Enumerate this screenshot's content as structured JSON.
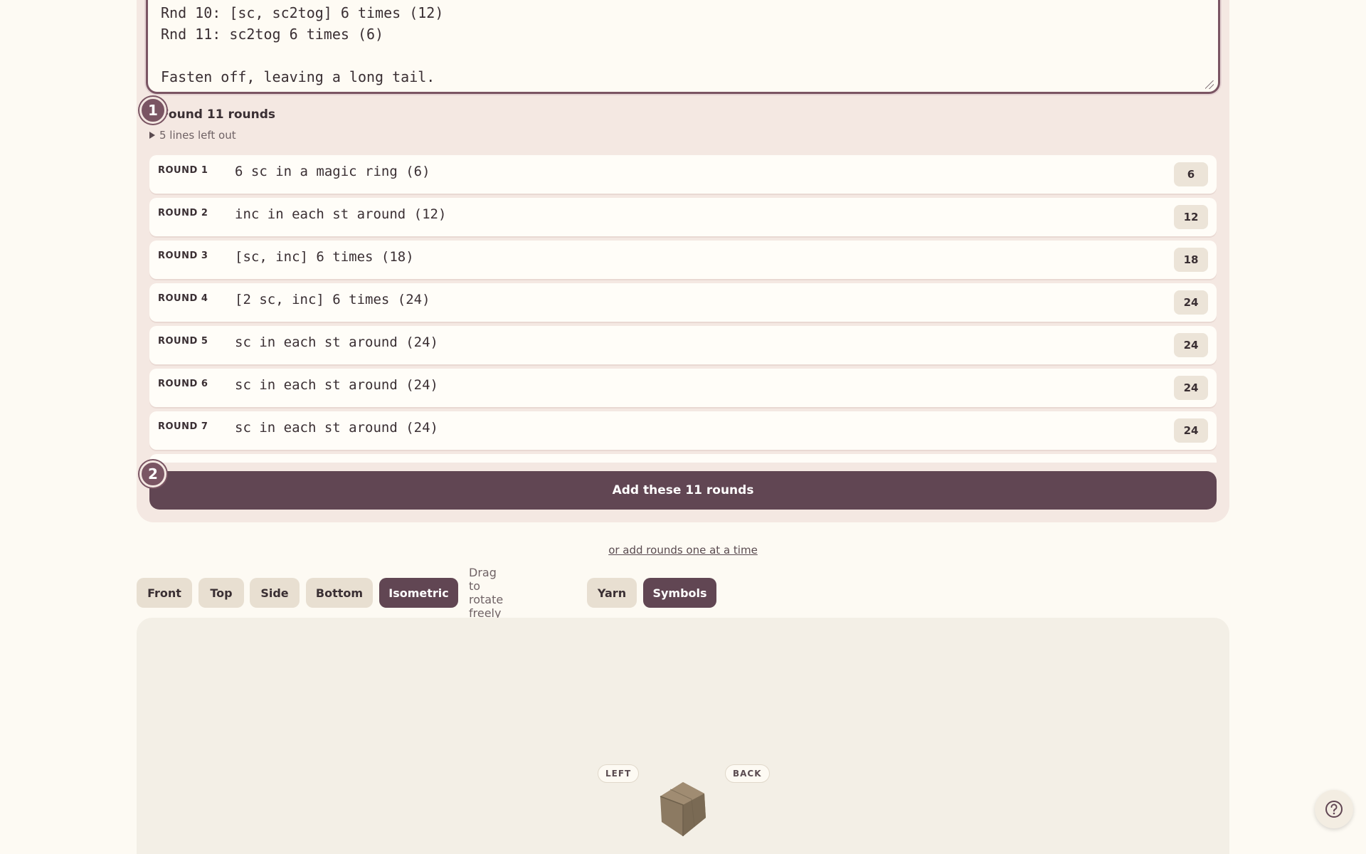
{
  "pattern_text": {
    "lines": [
      "Rnd 10: [sc, sc2tog] 6 times (12)",
      "Rnd 11: sc2tog 6 times (6)",
      "",
      "Fasten off, leaving a long tail."
    ]
  },
  "step_badges": [
    "1",
    "2"
  ],
  "import": {
    "found_title": "Found 11 rounds",
    "left_out_label": "5 lines left out",
    "add_button_label": "Add these 11 rounds"
  },
  "rounds": [
    {
      "label": "ROUND 1",
      "text": "6 sc in a magic ring (6)",
      "count": "6"
    },
    {
      "label": "ROUND 2",
      "text": "inc in each st around (12)",
      "count": "12"
    },
    {
      "label": "ROUND 3",
      "text": "[sc, inc] 6 times (18)",
      "count": "18"
    },
    {
      "label": "ROUND 4",
      "text": "[2 sc, inc] 6 times (24)",
      "count": "24"
    },
    {
      "label": "ROUND 5",
      "text": "sc in each st around (24)",
      "count": "24"
    },
    {
      "label": "ROUND 6",
      "text": "sc in each st around (24)",
      "count": "24"
    },
    {
      "label": "ROUND 7",
      "text": "sc in each st around (24)",
      "count": "24"
    }
  ],
  "one_at_a_time_link": "or add rounds one at a time",
  "view_toolbar": {
    "views": [
      "Front",
      "Top",
      "Side",
      "Bottom",
      "Isometric"
    ],
    "active_view": "Isometric",
    "hint": "Drag to rotate freely",
    "toggles": [
      "Yarn",
      "Symbols"
    ],
    "active_toggle": "Symbols"
  },
  "viewport": {
    "tag_left": "LEFT",
    "tag_back": "BACK",
    "model_color": "#8c7a62"
  },
  "icons": {
    "help": "help-circle-icon",
    "expand": "triangle-right-icon",
    "resize": "resize-grip-icon"
  }
}
